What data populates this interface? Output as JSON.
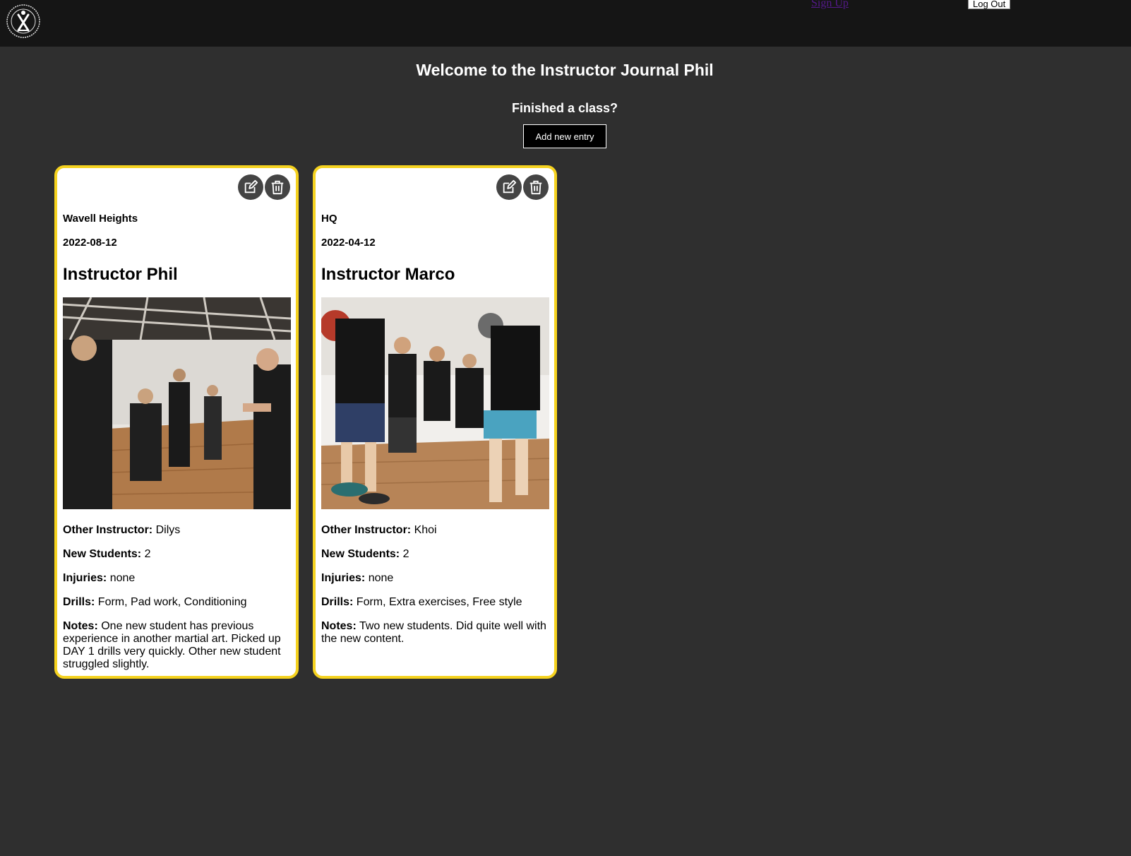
{
  "header": {
    "logo_name": "school-logo",
    "signup_label": "Sign Up",
    "logout_label": "Log Out"
  },
  "main": {
    "welcome": "Welcome to the Instructor Journal Phil",
    "prompt": "Finished a class?",
    "add_button": "Add new entry"
  },
  "labels": {
    "other_instructor": "Other Instructor:",
    "new_students": "New Students:",
    "injuries": "Injuries:",
    "drills": "Drills:",
    "notes": "Notes:"
  },
  "cards": [
    {
      "location": "Wavell Heights",
      "date": "2022-08-12",
      "instructor": "Instructor Phil",
      "other_instructor": "Dilys",
      "new_students": "2",
      "injuries": "none",
      "drills": "Form, Pad work, Conditioning",
      "notes": "One new student has previous experience in another martial art. Picked up DAY 1 drills very quickly. Other new student struggled slightly."
    },
    {
      "location": "HQ",
      "date": "2022-04-12",
      "instructor": "Instructor Marco",
      "other_instructor": "Khoi",
      "new_students": "2",
      "injuries": "none",
      "drills": "Form, Extra exercises, Free style",
      "notes": "Two new students. Did quite well with the new content."
    }
  ],
  "colors": {
    "accent_border": "#f5d21f",
    "background": "#2f2f2f",
    "topbar": "#151515"
  },
  "icons": {
    "edit": "edit-icon",
    "delete": "trash-icon"
  }
}
